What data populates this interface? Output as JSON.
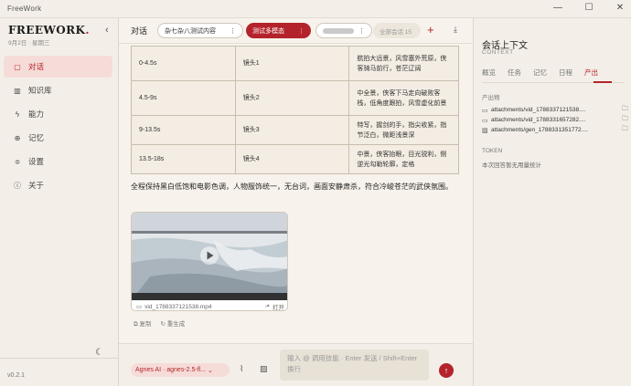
{
  "window": {
    "title": "FreeWork",
    "controls": [
      "—",
      "☐",
      "✕"
    ]
  },
  "brand": {
    "name": "FREEWORK",
    "dot": ".",
    "date": "9月2日  ·  星期三"
  },
  "sidebar": {
    "items": [
      {
        "icon": "▢",
        "label": "对话"
      },
      {
        "icon": "▥",
        "label": "知识库"
      },
      {
        "icon": "ϟ",
        "label": "能力"
      },
      {
        "icon": "⊕",
        "label": "记忆"
      },
      {
        "icon": "≑",
        "label": "设置"
      },
      {
        "icon": "ⓘ",
        "label": "关于"
      }
    ],
    "version": "v0.2.1"
  },
  "tabbar": {
    "label": "对话",
    "chips": [
      {
        "label": "杂七杂八测试内容",
        "menu": "⋮"
      },
      {
        "label": "测试多模态",
        "menu": "⋮"
      },
      {
        "label": "",
        "menu": "⋮"
      }
    ],
    "all_conversations": "全部会话 15",
    "plus": "+"
  },
  "shots_table": {
    "rows": [
      {
        "time": "0-4.5s",
        "shot": "镜头1",
        "desc": "航拍大远景，风雪塞外荒原，侠客骑马前行，苍茫辽阔"
      },
      {
        "time": "4.5-9s",
        "shot": "镜头2",
        "desc": "中全景，侠客下马走向破败客栈，低角度跟拍，风雪虚化前景"
      },
      {
        "time": "9-13.5s",
        "shot": "镜头3",
        "desc": "特写，握剑的手，指尖收紧，指节泛白，微距浅景深"
      },
      {
        "time": "13.5-18s",
        "shot": "镜头4",
        "desc": "中景，侠客抬眼，目光锐利，侧逆光勾勒轮廓，定格"
      }
    ]
  },
  "message_text": "全程保持黑白低饱和电影色调，人物服饰统一，无台词，画面安静肃杀，符合冷峻苍茫的武侠氛围。",
  "video": {
    "filename": "vid_1788337121538.mp4",
    "open_label": "打开"
  },
  "message_actions": {
    "copy": "复制",
    "regenerate": "重生成"
  },
  "composer": {
    "model": "Agnes AI · agnes-2.5-fl...",
    "placeholder": "输入 @ 调用技能 · Enter 发送 / Shift+Enter 换行"
  },
  "context_panel": {
    "title": "会话上下文",
    "subtitle": "CONTEXT",
    "tabs": [
      "概览",
      "任务",
      "记忆",
      "日程",
      "产出"
    ],
    "active_tab": "产出",
    "artifacts_label": "产出物",
    "artifacts": [
      {
        "type": "▭",
        "path": "attachments/vid_1788337121538...."
      },
      {
        "type": "▭",
        "path": "attachments/vid_1788331657282...."
      },
      {
        "type": "▨",
        "path": "attachments/gen_1788331351772...."
      }
    ],
    "token_label": "TOKEN",
    "token_text": "本次回答暂无用量统计"
  },
  "colors": {
    "accent": "#b4232b",
    "active_bg": "#f6dcd8",
    "main_bg": "#f7f3ec",
    "side_bg": "#f3efe8"
  }
}
